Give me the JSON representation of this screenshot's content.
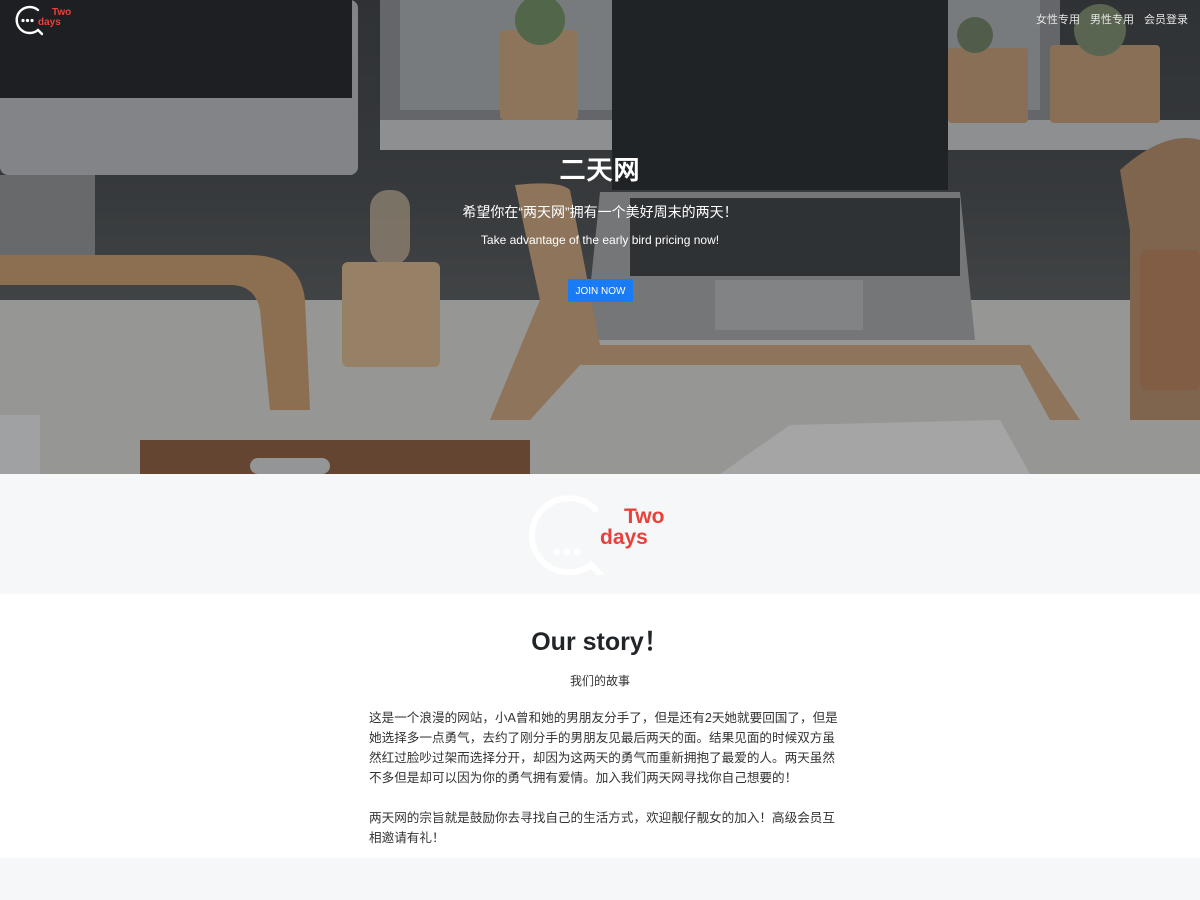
{
  "navbar": {
    "brand_line1": "Two",
    "brand_line2": "days",
    "links": [
      "女性专用",
      "男性专用",
      "会员登录"
    ]
  },
  "hero": {
    "title": "二天网",
    "subtitle_cn": "希望你在“两天网”拥有一个美好周末的两天！",
    "subtitle_en": "Take advantage of the early bird pricing now!",
    "cta_label": "JOIN NOW"
  },
  "logo": {
    "line1": "Two",
    "line2": "days"
  },
  "story": {
    "title": "Our story！",
    "subtitle": "我们的故事",
    "paragraph1": "这是一个浪漫的网站，小A曾和她的男朋友分手了，但是还有2天她就要回国了，但是她选择多一点勇气，去约了刚分手的男朋友见最后两天的面。结果见面的时候双方虽然红过脸吵过架而选择分开，却因为这两天的勇气而重新拥抱了最爱的人。两天虽然不多但是却可以因为你的勇气拥有爱情。加入我们两天网寻找你自己想要的！",
    "paragraph2": "两天网的宗旨就是鼓励你去寻找自己的生活方式，欢迎靓仔靓女的加入！高级会员互相邀请有礼！"
  },
  "colors": {
    "brand_red": "#e8413c",
    "button_blue": "#1a7cf5"
  }
}
